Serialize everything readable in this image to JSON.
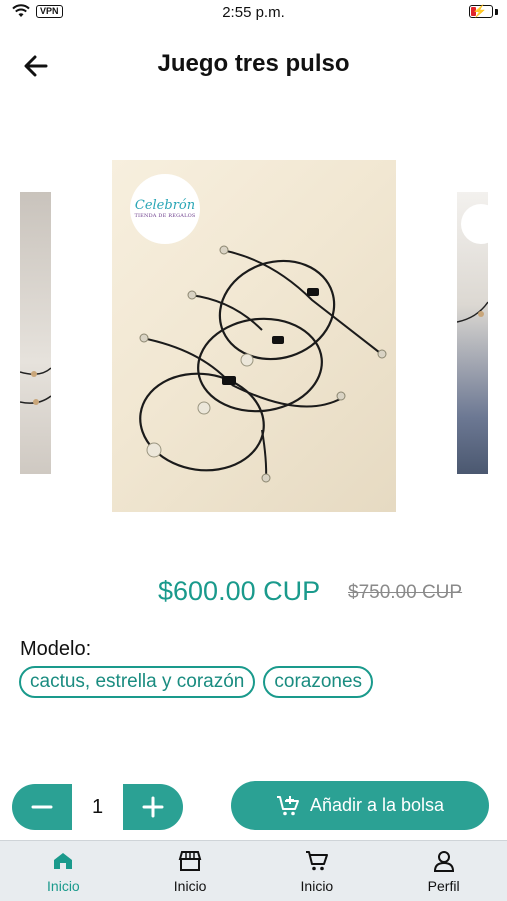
{
  "status_bar": {
    "time": "2:55 p.m.",
    "vpn_label": "VPN",
    "icons": [
      "wifi-icon",
      "vpn-icon",
      "battery-charging-icon"
    ],
    "battery_level": 0.25
  },
  "header": {
    "title": "Juego tres pulso",
    "back_icon": "arrow-left-icon"
  },
  "product": {
    "image_logo_text": "Celebrón",
    "image_logo_subtext": "TIENDA DE REGALOS",
    "price": "$600.00 CUP",
    "old_price": "$750.00 CUP"
  },
  "options": {
    "label": "Modelo:",
    "chips": [
      "cactus, estrella y corazón",
      "corazones"
    ]
  },
  "quantity": {
    "value": "1",
    "minus_icon": "minus-icon",
    "plus_icon": "plus-icon"
  },
  "add_button": {
    "label": "Añadir a la bolsa",
    "icon": "cart-plus-icon"
  },
  "tabbar": {
    "items": [
      {
        "label": "Inicio",
        "icon": "home-icon",
        "active": true
      },
      {
        "label": "Inicio",
        "icon": "store-icon",
        "active": false
      },
      {
        "label": "Inicio",
        "icon": "cart-icon",
        "active": false
      },
      {
        "label": "Perfil",
        "icon": "user-icon",
        "active": false
      }
    ]
  },
  "colors": {
    "accent": "#2ba194",
    "accent_text": "#1a9a8c",
    "tabbar_bg": "#e8ecef"
  }
}
